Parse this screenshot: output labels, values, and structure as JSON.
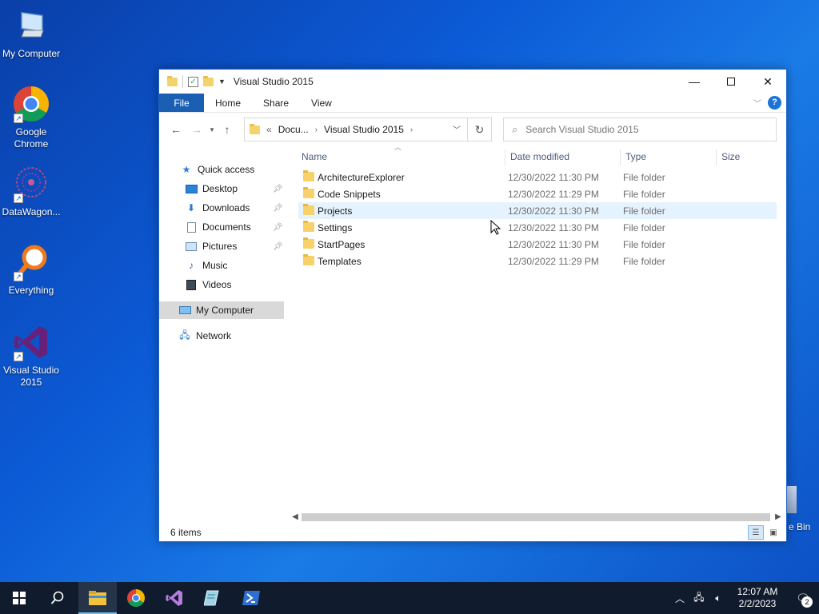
{
  "desktop": {
    "icons": [
      {
        "label": "My Computer"
      },
      {
        "label": "Google Chrome"
      },
      {
        "label": "DataWagon..."
      },
      {
        "label": "Everything"
      },
      {
        "label": "Visual Studio 2015"
      }
    ],
    "recycle_bin_partial_label": "e Bin"
  },
  "window": {
    "title": "Visual Studio 2015",
    "ribbon_tabs": [
      "File",
      "Home",
      "Share",
      "View"
    ],
    "address": {
      "root_marker": "«",
      "crumbs": [
        "Docu...",
        "Visual Studio 2015"
      ]
    },
    "search": {
      "placeholder": "Search Visual Studio 2015"
    },
    "nav_pane": {
      "quick_access": "Quick access",
      "items": [
        "Desktop",
        "Downloads",
        "Documents",
        "Pictures",
        "Music",
        "Videos"
      ],
      "my_computer": "My Computer",
      "network": "Network"
    },
    "columns": {
      "name": "Name",
      "date": "Date modified",
      "type": "Type",
      "size": "Size"
    },
    "files": [
      {
        "name": "ArchitectureExplorer",
        "date": "12/30/2022 11:30 PM",
        "type": "File folder"
      },
      {
        "name": "Code Snippets",
        "date": "12/30/2022 11:29 PM",
        "type": "File folder"
      },
      {
        "name": "Projects",
        "date": "12/30/2022 11:30 PM",
        "type": "File folder"
      },
      {
        "name": "Settings",
        "date": "12/30/2022 11:30 PM",
        "type": "File folder"
      },
      {
        "name": "StartPages",
        "date": "12/30/2022 11:30 PM",
        "type": "File folder"
      },
      {
        "name": "Templates",
        "date": "12/30/2022 11:29 PM",
        "type": "File folder"
      }
    ],
    "status": "6 items"
  },
  "taskbar": {
    "time": "12:07 AM",
    "date": "2/2/2023",
    "notification_count": "2"
  },
  "colors": {
    "accent": "#1a5fb4",
    "folder": "#f7d26a",
    "selection": "#d9d9d9",
    "hover": "#e5f3ff",
    "taskbar": "#101b2d"
  }
}
